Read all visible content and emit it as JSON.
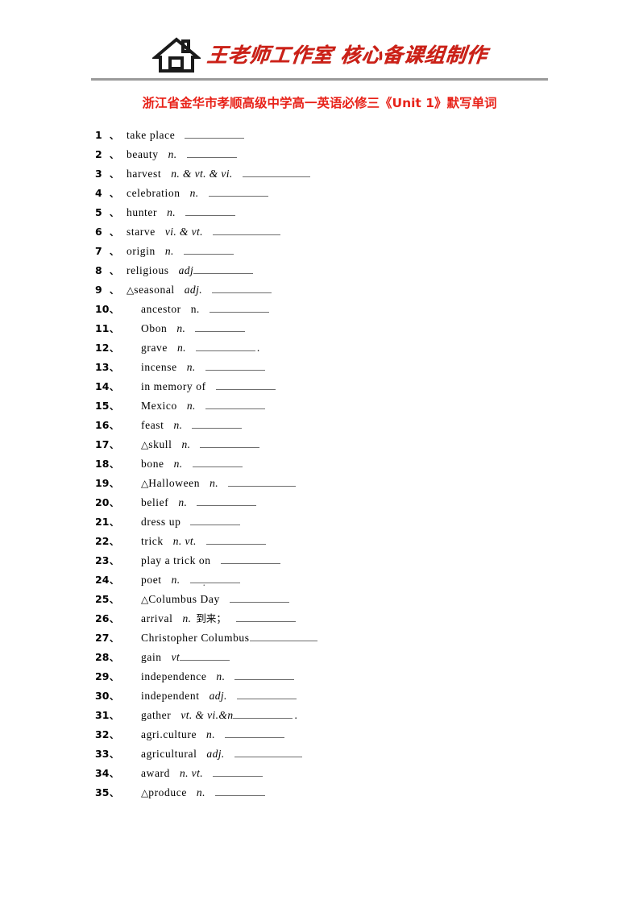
{
  "header": {
    "logo_icon": "house-icon",
    "brand_text": "王老师工作室  核心备课组制作",
    "brand_color": "#cc2118"
  },
  "title": {
    "text": "浙江省金华市孝顺高级中学高一英语必修三《Unit 1》默写单词",
    "color": "#e8231a"
  },
  "list": {
    "separator": "、",
    "items": [
      {
        "num": "1",
        "marker": "",
        "term": "take place",
        "pos": "",
        "cn": "",
        "tail": ""
      },
      {
        "num": "2",
        "marker": "",
        "term": "beauty",
        "pos": "n.",
        "cn": "",
        "tail": ""
      },
      {
        "num": "3",
        "marker": "",
        "term": "harvest",
        "pos": "n. & vt. & vi.",
        "cn": "",
        "tail": ""
      },
      {
        "num": "4",
        "marker": "",
        "term": "celebration",
        "pos": "n.",
        "cn": "",
        "tail": ""
      },
      {
        "num": "5",
        "marker": "",
        "term": "hunter",
        "pos": "n.",
        "cn": "",
        "tail": ""
      },
      {
        "num": "6",
        "marker": "",
        "term": "starve",
        "pos": "vi. & vt.",
        "cn": "",
        "tail": ""
      },
      {
        "num": "7",
        "marker": "",
        "term": "origin",
        "pos": "n.",
        "cn": "",
        "tail": ""
      },
      {
        "num": "8",
        "marker": "",
        "term": "religious",
        "pos": "adj",
        "cn": "",
        "tail": ""
      },
      {
        "num": "9",
        "marker": "△",
        "term": "seasonal",
        "pos": "adj.",
        "cn": "",
        "tail": ""
      },
      {
        "num": "10",
        "marker": "",
        "term": "ancestor",
        "pos": "n.",
        "cn": "",
        "tail": ""
      },
      {
        "num": "11",
        "marker": "",
        "term": "Obon",
        "pos": "n.",
        "cn": "",
        "tail": ""
      },
      {
        "num": "12",
        "marker": "",
        "term": "grave",
        "pos": "n.",
        "cn": "",
        "tail": "."
      },
      {
        "num": "13",
        "marker": "",
        "term": "incense",
        "pos": "n.",
        "cn": "",
        "tail": ""
      },
      {
        "num": "14",
        "marker": "",
        "term": "in memory of",
        "pos": "",
        "cn": "",
        "tail": ""
      },
      {
        "num": "15",
        "marker": "",
        "term": "Mexico",
        "pos": "n.",
        "cn": "",
        "tail": ""
      },
      {
        "num": "16",
        "marker": "",
        "term": "feast",
        "pos": "n.",
        "cn": "",
        "tail": ""
      },
      {
        "num": "17",
        "marker": "△",
        "term": "skull",
        "pos": "n.",
        "cn": "",
        "tail": ""
      },
      {
        "num": "18",
        "marker": "",
        "term": "bone",
        "pos": "n.",
        "cn": "",
        "tail": ""
      },
      {
        "num": "19",
        "marker": "△",
        "term": "Halloween",
        "pos": "n.",
        "cn": "",
        "tail": ""
      },
      {
        "num": "20",
        "marker": "",
        "term": "belief",
        "pos": "n.",
        "cn": "",
        "tail": ""
      },
      {
        "num": "21",
        "marker": "",
        "term": "dress up",
        "pos": "",
        "cn": "",
        "tail": ""
      },
      {
        "num": "22",
        "marker": "",
        "term": "trick",
        "pos": "n.   vt.",
        "cn": "",
        "tail": ""
      },
      {
        "num": "23",
        "marker": "",
        "term": "play a trick on",
        "pos": "",
        "cn": "",
        "tail": ""
      },
      {
        "num": "24",
        "marker": "",
        "term": "poet",
        "pos": "n.",
        "cn": "",
        "tail": ""
      },
      {
        "num": "25",
        "marker": "△",
        "term": "Columbus Day",
        "pos": "",
        "cn": "",
        "tail": ""
      },
      {
        "num": "26",
        "marker": "",
        "term": "arrival",
        "pos": "n.",
        "cn": "到来；",
        "tail": ""
      },
      {
        "num": "27",
        "marker": "",
        "term": "Christopher Columbus",
        "pos": "",
        "cn": "",
        "tail": ""
      },
      {
        "num": "28",
        "marker": "",
        "term": "gain",
        "pos": "vt",
        "cn": "",
        "tail": ""
      },
      {
        "num": "29",
        "marker": "",
        "term": "independence",
        "pos": "n.",
        "cn": "",
        "tail": ""
      },
      {
        "num": "30",
        "marker": "",
        "term": "independent",
        "pos": "adj.",
        "cn": "",
        "tail": ""
      },
      {
        "num": "31",
        "marker": "",
        "term": "gather",
        "pos": "vt. & vi.&n",
        "cn": "",
        "tail": "."
      },
      {
        "num": "32",
        "marker": "",
        "term": "agri.culture",
        "pos": "n.",
        "cn": "",
        "tail": ""
      },
      {
        "num": "33",
        "marker": "",
        "term": "agricultural",
        "pos": "adj.",
        "cn": "",
        "tail": ""
      },
      {
        "num": "34",
        "marker": "",
        "term": "award",
        "pos": "n.  vt.",
        "cn": "",
        "tail": ""
      },
      {
        "num": "35",
        "marker": "△",
        "term": "produce",
        "pos": "n.",
        "cn": "",
        "tail": ""
      }
    ]
  }
}
